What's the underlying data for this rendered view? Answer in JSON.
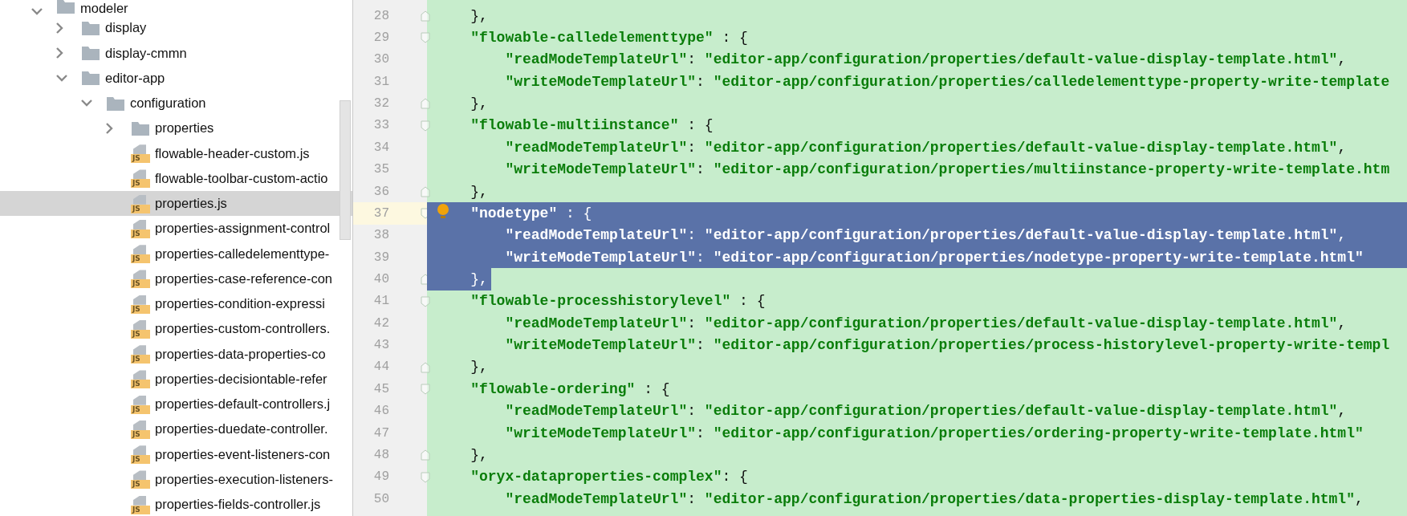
{
  "project_tree": {
    "items": [
      {
        "name": "modeler",
        "kind": "folder",
        "expanded": true,
        "selected": false,
        "children": [
          {
            "name": "display",
            "kind": "folder",
            "expanded": false,
            "selected": false
          },
          {
            "name": "display-cmmn",
            "kind": "folder",
            "expanded": false,
            "selected": false
          },
          {
            "name": "editor-app",
            "kind": "folder",
            "expanded": true,
            "selected": false,
            "children": [
              {
                "name": "configuration",
                "kind": "folder",
                "expanded": true,
                "selected": false,
                "children": [
                  {
                    "name": "properties",
                    "kind": "folder",
                    "expanded": false,
                    "selected": false
                  },
                  {
                    "name": "flowable-header-custom.js",
                    "kind": "file",
                    "icon_label": "JS",
                    "selected": false
                  },
                  {
                    "name": "flowable-toolbar-custom-actio",
                    "kind": "file",
                    "icon_label": "JS",
                    "selected": false
                  },
                  {
                    "name": "properties.js",
                    "kind": "file",
                    "icon_label": "JS",
                    "selected": true
                  },
                  {
                    "name": "properties-assignment-control",
                    "kind": "file",
                    "icon_label": "JS",
                    "selected": false
                  },
                  {
                    "name": "properties-calledelementtype-",
                    "kind": "file",
                    "icon_label": "JS",
                    "selected": false
                  },
                  {
                    "name": "properties-case-reference-con",
                    "kind": "file",
                    "icon_label": "JS",
                    "selected": false
                  },
                  {
                    "name": "properties-condition-expressi",
                    "kind": "file",
                    "icon_label": "JS",
                    "selected": false
                  },
                  {
                    "name": "properties-custom-controllers.",
                    "kind": "file",
                    "icon_label": "JS",
                    "selected": false
                  },
                  {
                    "name": "properties-data-properties-co",
                    "kind": "file",
                    "icon_label": "JS",
                    "selected": false
                  },
                  {
                    "name": "properties-decisiontable-refer",
                    "kind": "file",
                    "icon_label": "JS",
                    "selected": false
                  },
                  {
                    "name": "properties-default-controllers.j",
                    "kind": "file",
                    "icon_label": "JS",
                    "selected": false
                  },
                  {
                    "name": "properties-duedate-controller.",
                    "kind": "file",
                    "icon_label": "JS",
                    "selected": false
                  },
                  {
                    "name": "properties-event-listeners-con",
                    "kind": "file",
                    "icon_label": "JS",
                    "selected": false
                  },
                  {
                    "name": "properties-execution-listeners-",
                    "kind": "file",
                    "icon_label": "JS",
                    "selected": false
                  },
                  {
                    "name": "properties-fields-controller.js",
                    "kind": "file",
                    "icon_label": "JS",
                    "selected": false
                  }
                ]
              }
            ]
          }
        ]
      }
    ]
  },
  "editor": {
    "lines": [
      {
        "number": "28",
        "kind": "close",
        "text": "},",
        "selected": false,
        "current": false
      },
      {
        "number": "29",
        "kind": "open",
        "text": "\"flowable-calledelementtype\" : {",
        "selected": false,
        "current": false
      },
      {
        "number": "30",
        "kind": "entry",
        "text": "\"readModeTemplateUrl\": \"editor-app/configuration/properties/default-value-display-template.html\",",
        "selected": false,
        "current": false
      },
      {
        "number": "31",
        "kind": "entry",
        "text": "\"writeModeTemplateUrl\": \"editor-app/configuration/properties/calledelementtype-property-write-template",
        "selected": false,
        "current": false
      },
      {
        "number": "32",
        "kind": "close",
        "text": "},",
        "selected": false,
        "current": false
      },
      {
        "number": "33",
        "kind": "open",
        "text": "\"flowable-multiinstance\" : {",
        "selected": false,
        "current": false
      },
      {
        "number": "34",
        "kind": "entry",
        "text": "\"readModeTemplateUrl\": \"editor-app/configuration/properties/default-value-display-template.html\",",
        "selected": false,
        "current": false
      },
      {
        "number": "35",
        "kind": "entry",
        "text": "\"writeModeTemplateUrl\": \"editor-app/configuration/properties/multiinstance-property-write-template.htm",
        "selected": false,
        "current": false
      },
      {
        "number": "36",
        "kind": "close",
        "text": "},",
        "selected": false,
        "current": false
      },
      {
        "number": "37",
        "kind": "open",
        "text": "\"nodetype\" : {",
        "selected": true,
        "current": true
      },
      {
        "number": "38",
        "kind": "entry",
        "text": "\"readModeTemplateUrl\": \"editor-app/configuration/properties/default-value-display-template.html\",",
        "selected": true,
        "current": false
      },
      {
        "number": "39",
        "kind": "entry",
        "text": "\"writeModeTemplateUrl\": \"editor-app/configuration/properties/nodetype-property-write-template.html\"",
        "selected": true,
        "current": false
      },
      {
        "number": "40",
        "kind": "close",
        "text": "},",
        "selected": true,
        "current": false
      },
      {
        "number": "41",
        "kind": "open",
        "text": "\"flowable-processhistorylevel\" : {",
        "selected": false,
        "current": false
      },
      {
        "number": "42",
        "kind": "entry",
        "text": "\"readModeTemplateUrl\": \"editor-app/configuration/properties/default-value-display-template.html\",",
        "selected": false,
        "current": false
      },
      {
        "number": "43",
        "kind": "entry",
        "text": "\"writeModeTemplateUrl\": \"editor-app/configuration/properties/process-historylevel-property-write-templ",
        "selected": false,
        "current": false
      },
      {
        "number": "44",
        "kind": "close",
        "text": "},",
        "selected": false,
        "current": false
      },
      {
        "number": "45",
        "kind": "open",
        "text": "\"flowable-ordering\" : {",
        "selected": false,
        "current": false
      },
      {
        "number": "46",
        "kind": "entry",
        "text": "\"readModeTemplateUrl\": \"editor-app/configuration/properties/default-value-display-template.html\",",
        "selected": false,
        "current": false
      },
      {
        "number": "47",
        "kind": "entry",
        "text": "\"writeModeTemplateUrl\": \"editor-app/configuration/properties/ordering-property-write-template.html\"",
        "selected": false,
        "current": false
      },
      {
        "number": "48",
        "kind": "close",
        "text": "},",
        "selected": false,
        "current": false
      },
      {
        "number": "49",
        "kind": "open",
        "text": "\"oryx-dataproperties-complex\": {",
        "selected": false,
        "current": false
      },
      {
        "number": "50",
        "kind": "entry",
        "text": "\"readModeTemplateUrl\": \"editor-app/configuration/properties/data-properties-display-template.html\",",
        "selected": false,
        "current": false
      }
    ]
  }
}
